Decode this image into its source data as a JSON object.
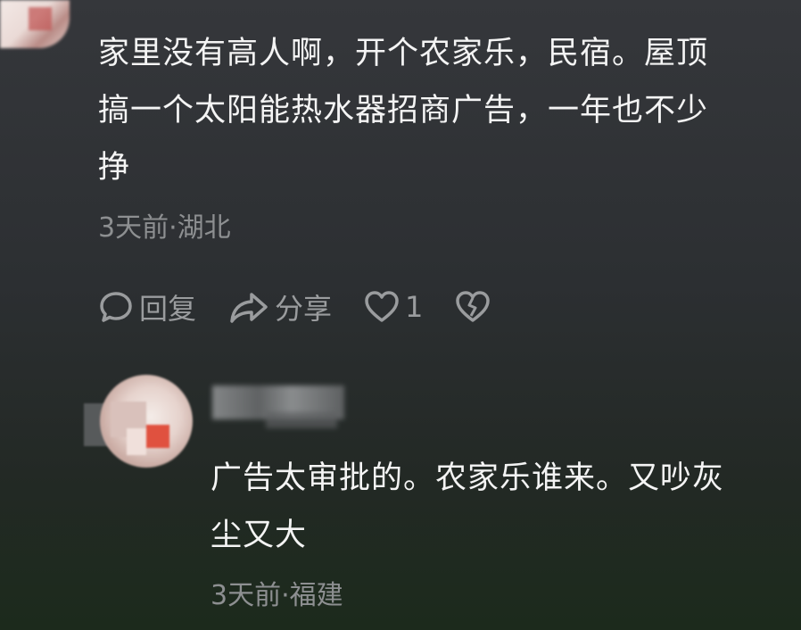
{
  "comments": [
    {
      "text": "家里没有高人啊，开个农家乐，民宿。屋顶\n搞一个太阳能热水器招商广告，一年也不少\n挣",
      "meta": "3天前·湖北",
      "actions": {
        "reply_label": "回复",
        "share_label": "分享",
        "like_count": "1"
      }
    },
    {
      "text": "广告太审批的。农家乐谁来。又吵灰\n尘又大",
      "meta": "3天前·福建"
    }
  ],
  "icons": [
    "comment-bubble-icon",
    "share-arrow-icon",
    "heart-icon",
    "broken-heart-icon"
  ],
  "colors": {
    "text": "#f4f4f4",
    "meta": "#8d8f91",
    "action": "#9a9c9e"
  }
}
